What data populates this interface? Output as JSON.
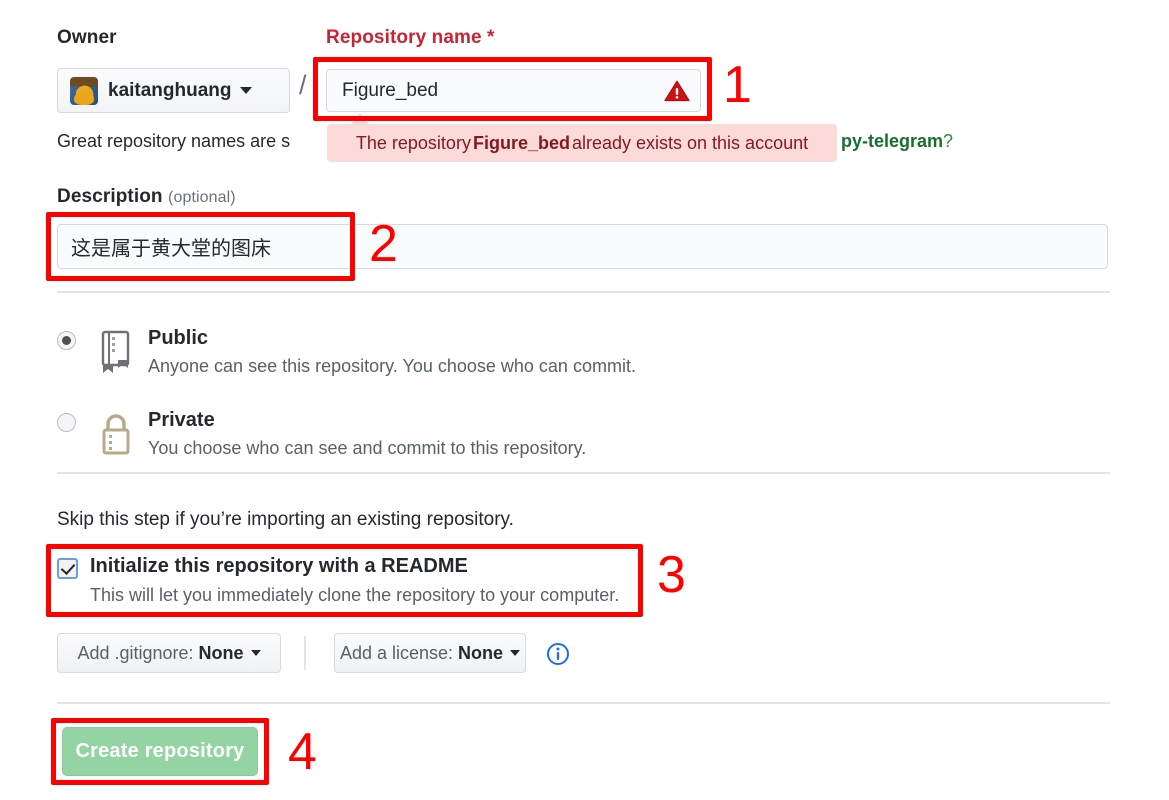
{
  "owner": {
    "label": "Owner",
    "name": "kaitanghuang",
    "avatar_icon": "user-avatar-pikachu",
    "separator": "/"
  },
  "repository_name": {
    "label": "Repository name *",
    "value": "Figure_bed",
    "placeholder": "",
    "status_icon": "warning-triangle-icon",
    "status_color": "#cb2431"
  },
  "hint": {
    "text": "Great repository names are s",
    "suffix": "py-telegram",
    "suffix_punctuation": "?",
    "suffix_color": "#176f2c"
  },
  "tooltip": {
    "prefix": "The repository ",
    "emphasis": "Figure_bed",
    "suffix": " already exists on this account",
    "background": "#fbdada",
    "color": "#86181d"
  },
  "description": {
    "label": "Description",
    "optional_label": "(optional)",
    "value": "这是属于黄大堂的图床",
    "placeholder": ""
  },
  "visibility": {
    "options": [
      {
        "title": "Public",
        "description": "Anyone can see this repository. You choose who can commit.",
        "icon": "public-book-icon",
        "selected": true
      },
      {
        "title": "Private",
        "description": "You choose who can see and commit to this repository.",
        "icon": "private-lock-icon",
        "selected": false
      }
    ]
  },
  "initialize": {
    "skip_text": "Skip this step if you’re importing an existing repository.",
    "checkbox_label": "Initialize this repository with a README",
    "checkbox_description": "This will let you immediately clone the repository to your computer.",
    "checked": true
  },
  "options": {
    "gitignore_prefix": "Add .gitignore:",
    "gitignore_value": "None",
    "license_prefix": "Add a license:",
    "license_value": "None",
    "info_icon": "info-circle-icon"
  },
  "submit": {
    "label": "Create repository",
    "disabled": true,
    "color": "#94d3a2"
  },
  "annotations": {
    "box1": "1",
    "box2": "2",
    "box3": "3",
    "box4": "4",
    "color": "#fe0000"
  }
}
